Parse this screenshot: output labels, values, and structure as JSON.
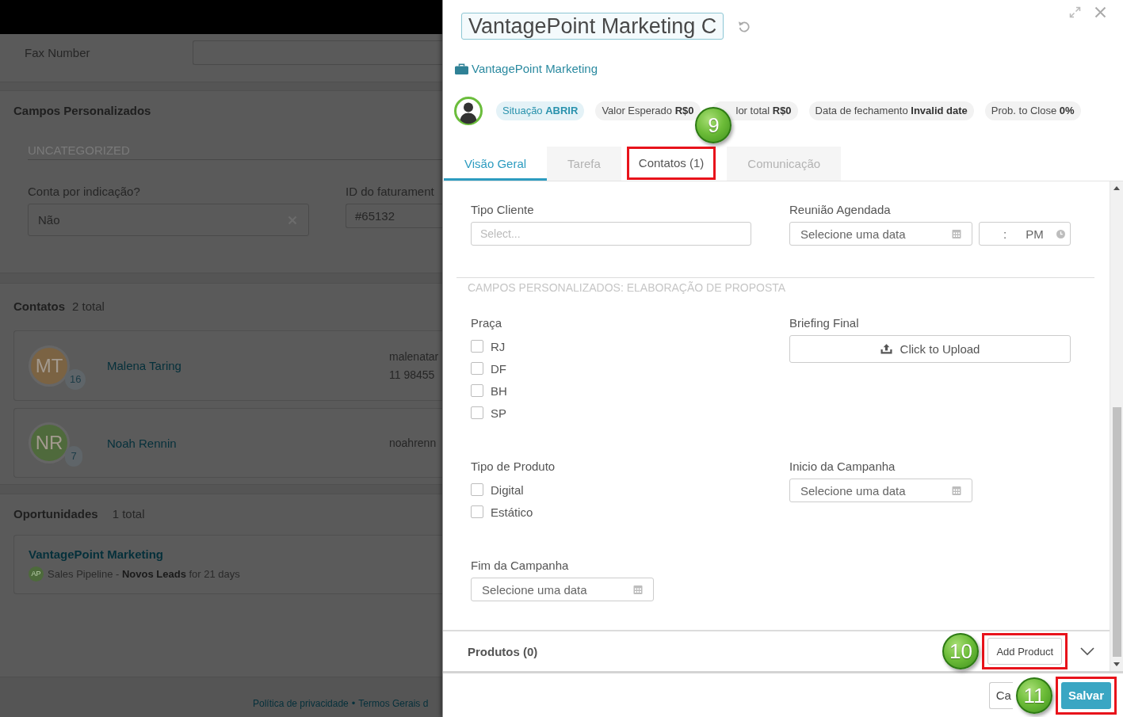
{
  "background_page": {
    "fax_field": {
      "label": "Fax Number"
    },
    "custom_fields": {
      "title": "Campos Personalizados",
      "category": "UNCATEGORIZED",
      "fields": [
        {
          "kind": "select",
          "label": "Conta por indicação?",
          "value": "Não"
        },
        {
          "kind": "text",
          "label": "ID do faturament",
          "value": "#65132"
        }
      ]
    },
    "contacts": {
      "title": "Contatos",
      "count": "2 total",
      "items": [
        {
          "initials": "MT",
          "color": "#7b6343",
          "badge": "16",
          "name": "Malena Taring",
          "email": "malenatar",
          "phone": "11 98455"
        },
        {
          "initials": "NR",
          "color": "#4f6a3c",
          "badge": "7",
          "name": "Noah Rennin",
          "email": "noahrenn"
        }
      ]
    },
    "opportunities": {
      "title": "Oportunidades",
      "count": "1 total",
      "items": [
        {
          "name": "VantagePoint Marketing",
          "owner": "AP",
          "detail": "Sales Pipeline - **Novos Leads** for 21 days"
        }
      ]
    },
    "footer_links": [
      "Política de privacidade",
      "Termos Gerais d"
    ],
    "footer_separator": "•"
  },
  "panel": {
    "title": "VantagePoint Marketing C",
    "company": "VantagePoint Marketing",
    "chips": [
      {
        "kind": "status",
        "text": "Situação **ABRIR**"
      },
      {
        "kind": "info",
        "text": "Valor Esperado **R$0**"
      },
      {
        "kind": "info",
        "text": "lor total **R$0**"
      },
      {
        "kind": "info",
        "text": "Data de fechamento **Invalid date**"
      },
      {
        "kind": "info",
        "text": "Prob. to Close **0%**"
      }
    ],
    "tabs": [
      {
        "label": "Visão Geral",
        "selected": true,
        "highlighted": false
      },
      {
        "label": "Tarefa",
        "selected": false,
        "highlighted": false
      },
      {
        "label": "Contatos (1)",
        "selected": false,
        "highlighted": true,
        "annotation": "9"
      },
      {
        "label": "Comunicação",
        "selected": false,
        "highlighted": false
      }
    ],
    "form": {
      "fields": [
        {
          "kind": "select",
          "label": "Tipo Cliente",
          "placeholder": "Select..."
        },
        {
          "kind": "datetime",
          "label": "Reunião Agendada",
          "placeholder": "Selecione uma data",
          "time_separator": ":",
          "time_period": "PM"
        }
      ],
      "section": {
        "title": "CAMPOS PERSONALIZADOS: ELABORAÇÃO DE PROPOSTA",
        "fields": [
          {
            "kind": "checkboxes",
            "label": "Praça",
            "options": [
              {
                "label": "RJ",
                "checked": false
              },
              {
                "label": "DF",
                "checked": false
              },
              {
                "label": "BH",
                "checked": false
              },
              {
                "label": "SP",
                "checked": false
              }
            ]
          },
          {
            "kind": "upload",
            "label": "Briefing Final",
            "button": "Click to Upload"
          },
          {
            "kind": "checkboxes",
            "label": "Tipo de Produto",
            "options": [
              {
                "label": "Digital",
                "checked": false
              },
              {
                "label": "Estático",
                "checked": false
              }
            ]
          },
          {
            "kind": "date",
            "label": "Inicio da Campanha",
            "placeholder": "Selecione uma data"
          },
          {
            "kind": "date",
            "label": "Fim da Campanha",
            "placeholder": "Selecione uma data"
          }
        ]
      }
    },
    "products": {
      "title": "Produtos (0)",
      "add_button": {
        "label": "Add Product",
        "annotation": "10"
      }
    },
    "footer_buttons": [
      {
        "kind": "secondary",
        "label": "Ca"
      },
      {
        "kind": "primary",
        "label": "Salvar",
        "annotation": "11"
      }
    ]
  }
}
